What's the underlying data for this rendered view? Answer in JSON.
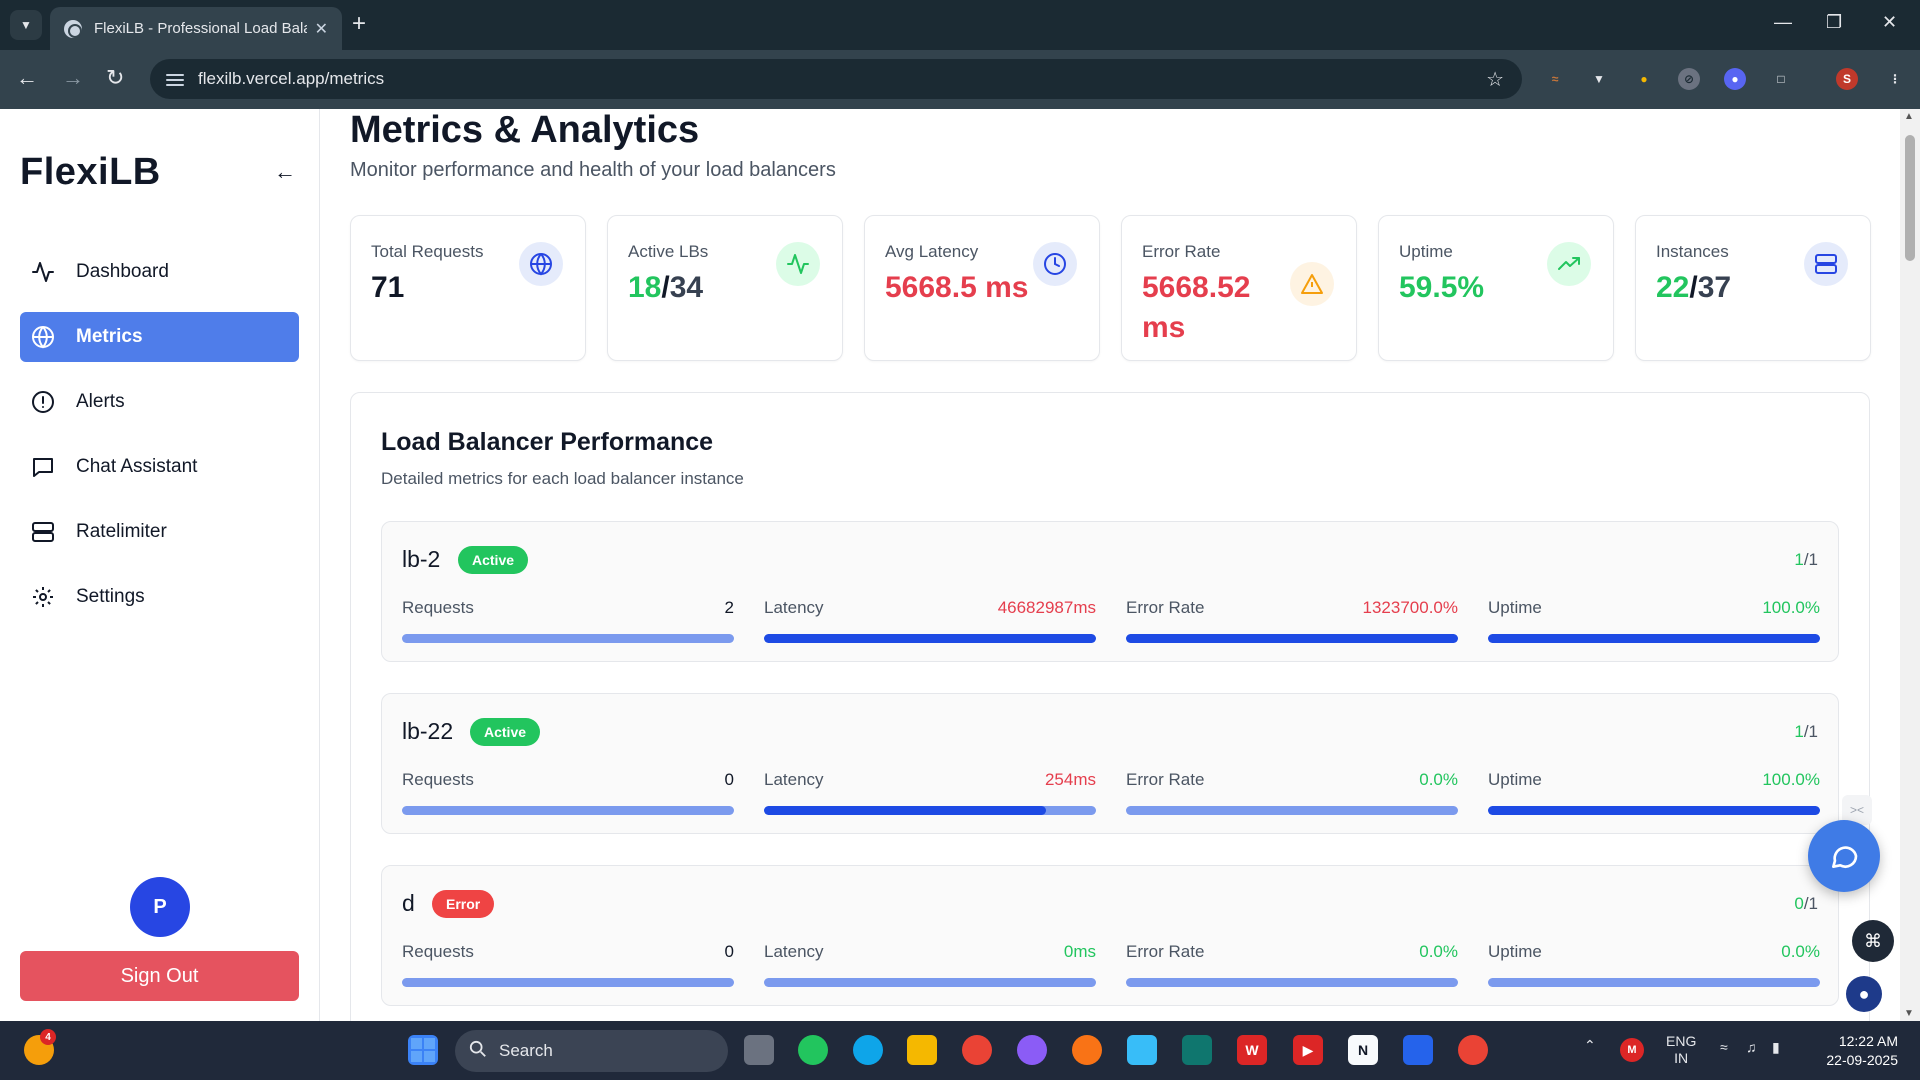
{
  "browser": {
    "tab_title": "FlexiLB - Professional Load Bala",
    "url": "flexilb.vercel.app/metrics",
    "profile_initial": "S"
  },
  "sidebar": {
    "brand": "FlexiLB",
    "items": [
      {
        "label": "Dashboard",
        "icon": "activity-icon"
      },
      {
        "label": "Metrics",
        "icon": "globe-icon"
      },
      {
        "label": "Alerts",
        "icon": "alert-circle-icon"
      },
      {
        "label": "Chat Assistant",
        "icon": "chat-icon"
      },
      {
        "label": "Ratelimiter",
        "icon": "server-icon"
      },
      {
        "label": "Settings",
        "icon": "gear-icon"
      }
    ],
    "active_item": "Metrics",
    "avatar_initial": "P",
    "sign_out_label": "Sign Out"
  },
  "page": {
    "title": "Metrics & Analytics",
    "subtitle": "Monitor performance and health of your load balancers"
  },
  "stats": [
    {
      "label": "Total Requests",
      "value": "71",
      "icon": "globe-icon"
    },
    {
      "label": "Active LBs",
      "value_a": "18",
      "separator": "/",
      "value_b": "34",
      "icon": "activity-icon"
    },
    {
      "label": "Avg Latency",
      "value": "5668.5 ms",
      "icon": "clock-icon"
    },
    {
      "label": "Error Rate",
      "value": "5668.52 ms",
      "icon": "warning-icon"
    },
    {
      "label": "Uptime",
      "value": "59.5%",
      "icon": "trending-up-icon"
    },
    {
      "label": "Instances",
      "value_a": "22",
      "separator": "/",
      "value_b": "37",
      "icon": "server-icon"
    }
  ],
  "performance": {
    "title": "Load Balancer Performance",
    "subtitle": "Detailed metrics for each load balancer instance",
    "metric_labels": {
      "requests": "Requests",
      "latency": "Latency",
      "error_rate": "Error Rate",
      "uptime": "Uptime"
    },
    "load_balancers": [
      {
        "name": "lb-2",
        "status": "Active",
        "instances_up": "1",
        "instances_total": "/1",
        "requests": "2",
        "latency": "46682987ms",
        "error_rate": "1323700.0%",
        "uptime": "100.0%",
        "requests_fill": 0,
        "latency_fill": 1.0,
        "error_fill": 1.0,
        "uptime_fill": 1.0
      },
      {
        "name": "lb-22",
        "status": "Active",
        "instances_up": "1",
        "instances_total": "/1",
        "requests": "0",
        "latency": "254ms",
        "error_rate": "0.0%",
        "uptime": "100.0%",
        "requests_fill": 0,
        "latency_fill": 0.85,
        "error_fill": 0,
        "uptime_fill": 1.0
      },
      {
        "name": "d",
        "status": "Error",
        "instances_up": "0",
        "instances_total": "/1",
        "requests": "0",
        "latency": "0ms",
        "error_rate": "0.0%",
        "uptime": "0.0%",
        "requests_fill": 0,
        "latency_fill": 0,
        "error_fill": 0,
        "uptime_fill": 0
      }
    ]
  },
  "taskbar": {
    "search_placeholder": "Search",
    "weather_badge": "4",
    "lang_top": "ENG",
    "lang_bottom": "IN",
    "time": "12:22 AM",
    "date": "22-09-2025"
  },
  "colors": {
    "accent": "#4f7dea",
    "danger": "#e53e4d",
    "success": "#22c55e",
    "bar_track": "#7b9aee",
    "bar_fill": "#1d4ae4"
  }
}
